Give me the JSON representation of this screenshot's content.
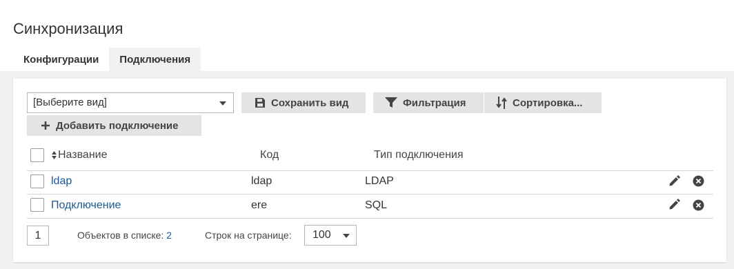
{
  "page": {
    "title": "Синхронизация"
  },
  "tabs": [
    {
      "label": "Конфигурации",
      "active": false
    },
    {
      "label": "Подключения",
      "active": true
    }
  ],
  "toolbar": {
    "view_select": "[Выберите вид]",
    "save_view": "Сохранить вид",
    "filter": "Фильтрация",
    "sort": "Сортировка...",
    "add_connection": "Добавить подключение"
  },
  "table": {
    "columns": [
      "Название",
      "Код",
      "Тип подключения"
    ],
    "rows": [
      {
        "name": "ldap",
        "code": "ldap",
        "type": "LDAP"
      },
      {
        "name": "Подключение",
        "code": "ere",
        "type": "SQL"
      }
    ]
  },
  "footer": {
    "page": "1",
    "objects_label": "Объектов в списке:",
    "objects_count": "2",
    "rows_label": "Строк на странице:",
    "rows_value": "100"
  },
  "colors": {
    "link": "#1a5a96",
    "button_bg": "#e3e4e5",
    "panel_bg": "#f0f1f2"
  }
}
